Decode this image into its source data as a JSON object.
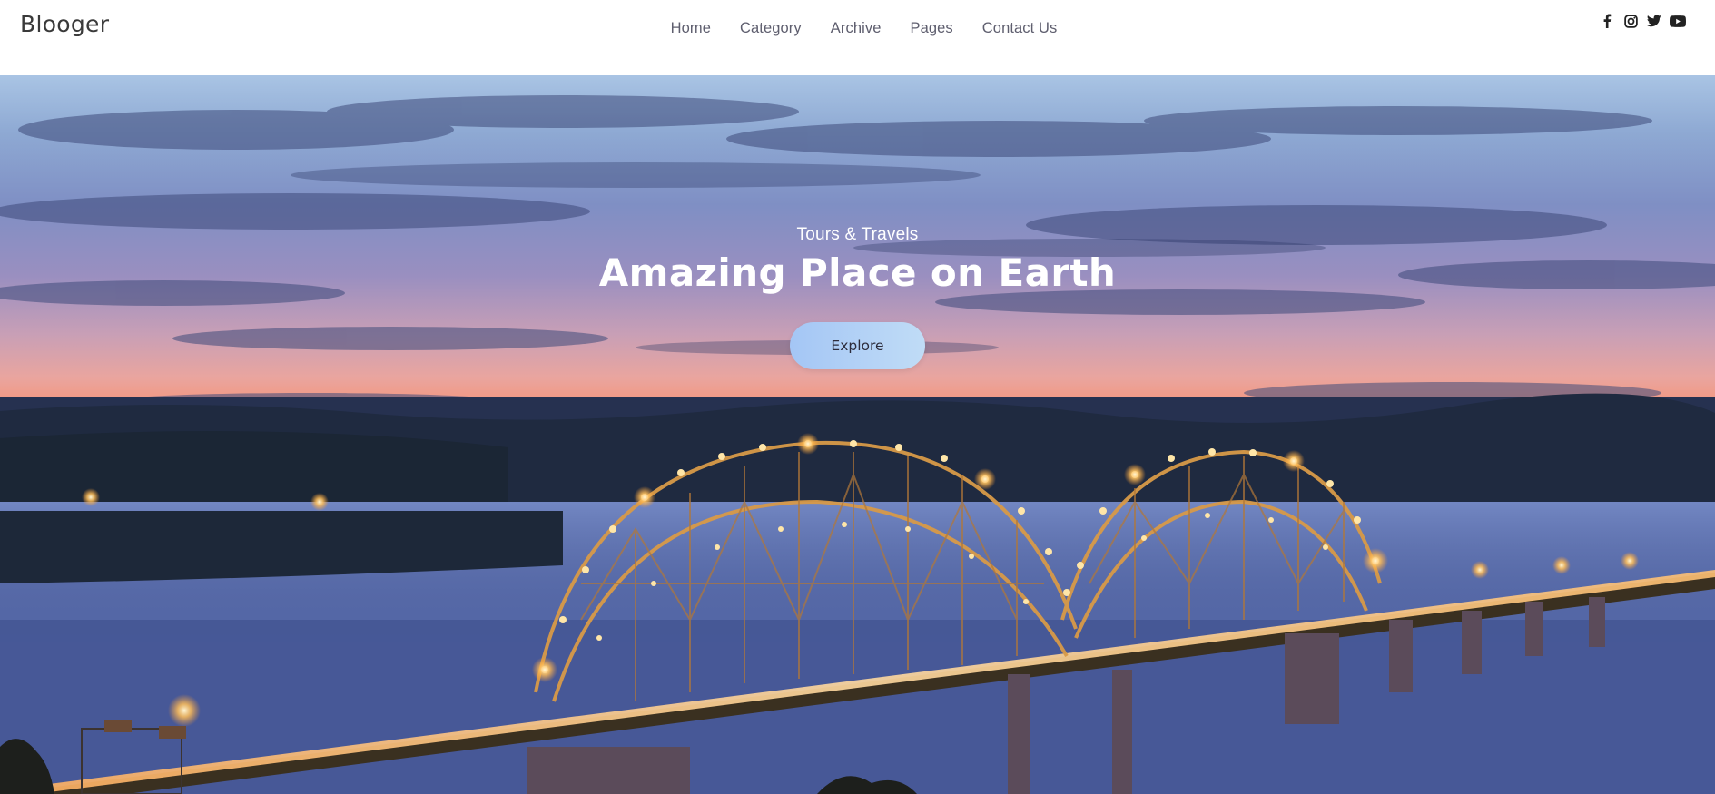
{
  "brand": {
    "name": "Blooger"
  },
  "nav": {
    "items": [
      {
        "label": "Home"
      },
      {
        "label": "Category"
      },
      {
        "label": "Archive"
      },
      {
        "label": "Pages"
      },
      {
        "label": "Contact Us"
      }
    ]
  },
  "social": {
    "icons": [
      "facebook-icon",
      "instagram-icon",
      "twitter-icon",
      "youtube-icon"
    ]
  },
  "hero": {
    "kicker": "Tours & Travels",
    "title": "Amazing Place on Earth",
    "button_label": "Explore",
    "image_subject": "illuminated arch bridge over river at sunset"
  },
  "colors": {
    "header_bg": "#ffffff",
    "nav_text": "#5e5e6e",
    "logo_text": "#3a3a3a",
    "hero_text": "#ffffff",
    "button_gradient_start": "#a4c6f5",
    "button_gradient_end": "#c0dcf6",
    "button_text": "#2c2c3c",
    "icon_color": "#222222"
  }
}
